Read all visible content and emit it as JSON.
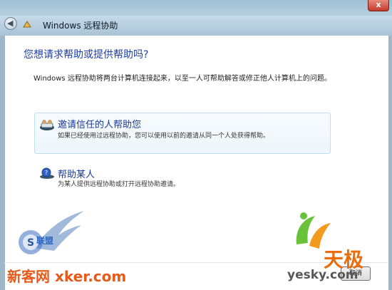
{
  "window": {
    "title": "Windows 远程协助",
    "close_label": "x"
  },
  "main": {
    "heading": "您想请求帮助或提供帮助吗?",
    "description": "Windows 远程协助将两台计算机连接起来，以至一人可帮助解答或修正他人计算机上的问题。"
  },
  "options": [
    {
      "title": "邀请信任的人帮助您",
      "subtitle": "如果已经使用过远程协助，您可以使用以前的邀请从同一个人处获得帮助。"
    },
    {
      "title": "帮助某人",
      "subtitle": "为某人提供远程协助或打开远程协助邀请。"
    }
  ],
  "footer": {
    "cancel_label": "取消"
  },
  "watermarks": {
    "left_text": "新客网 xker.com",
    "left_cjk": "联盟",
    "right_cjk": "天极",
    "right_url": "yesky.com"
  },
  "colors": {
    "heading": "#1f3ea8",
    "option_title": "#1a3a96",
    "watermark_orange": "#e65a1b",
    "watermark_blue": "#2a69c6"
  }
}
